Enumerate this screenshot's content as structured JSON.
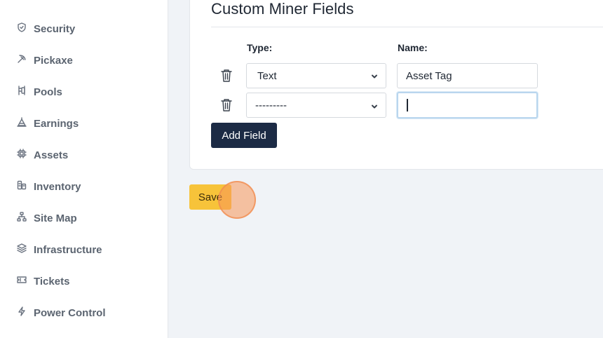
{
  "sidebar": {
    "items": [
      {
        "label": "Security",
        "icon": "shield-icon"
      },
      {
        "label": "Pickaxe",
        "icon": "pickaxe-icon"
      },
      {
        "label": "Pools",
        "icon": "pools-icon"
      },
      {
        "label": "Earnings",
        "icon": "earnings-icon"
      },
      {
        "label": "Assets",
        "icon": "chip-icon"
      },
      {
        "label": "Inventory",
        "icon": "inventory-icon"
      },
      {
        "label": "Site Map",
        "icon": "sitemap-icon"
      },
      {
        "label": "Infrastructure",
        "icon": "layers-icon"
      },
      {
        "label": "Tickets",
        "icon": "ticket-icon"
      },
      {
        "label": "Power Control",
        "icon": "bolt-icon"
      }
    ]
  },
  "card": {
    "title": "Custom Miner Fields",
    "type_label": "Type:",
    "name_label": "Name:",
    "rows": [
      {
        "type": "Text",
        "name": "Asset Tag"
      },
      {
        "type": "---------",
        "name": ""
      }
    ],
    "add_button": "Add Field"
  },
  "save_button": "Save"
}
